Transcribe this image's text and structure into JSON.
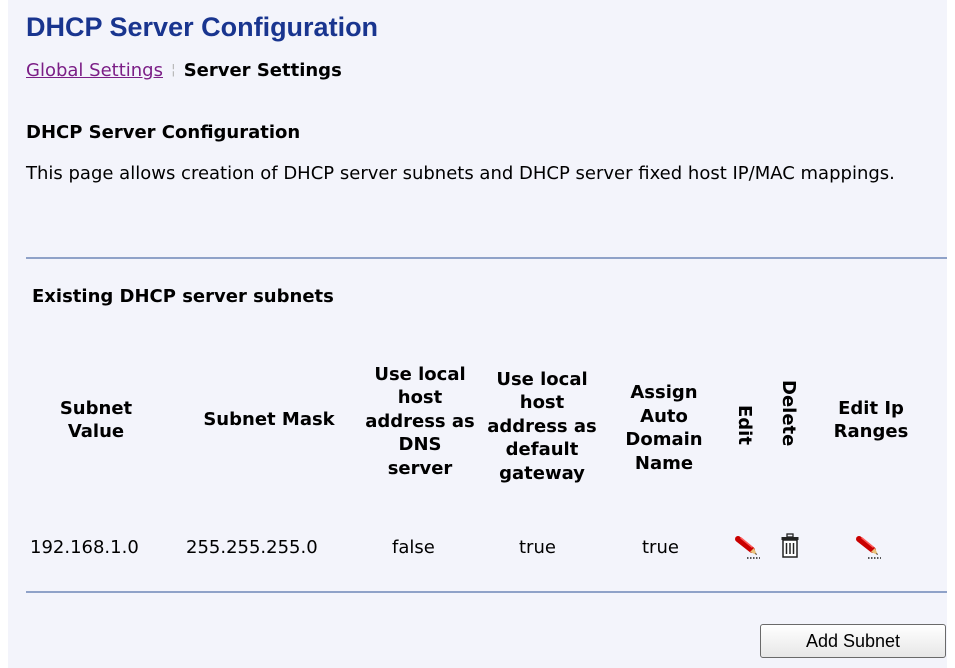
{
  "page": {
    "title": "DHCP Server Configuration",
    "breadcrumb": {
      "link": "Global Settings",
      "separator": "¦",
      "current": "Server Settings"
    },
    "section_title": "DHCP Server Configuration",
    "description": "This page allows creation of DHCP server subnets and DHCP server fixed host IP/MAC mappings."
  },
  "subnets": {
    "title": "Existing DHCP server subnets",
    "columns": {
      "subnet_value": "Subnet Value",
      "subnet_mask": "Subnet Mask",
      "dns": "Use local host address as DNS server",
      "gateway": "Use local host address as default gateway",
      "domain": "Assign Auto Domain Name",
      "edit": "Edit",
      "delete": "Delete",
      "ranges": "Edit Ip Ranges"
    },
    "rows": [
      {
        "subnet_value": "192.168.1.0",
        "subnet_mask": "255.255.255.0",
        "dns": "false",
        "gateway": "true",
        "domain": "true",
        "edit_icon": "pencil-icon",
        "delete_icon": "trash-icon",
        "ranges_icon": "pencil-icon"
      }
    ],
    "add_button": "Add Subnet"
  }
}
